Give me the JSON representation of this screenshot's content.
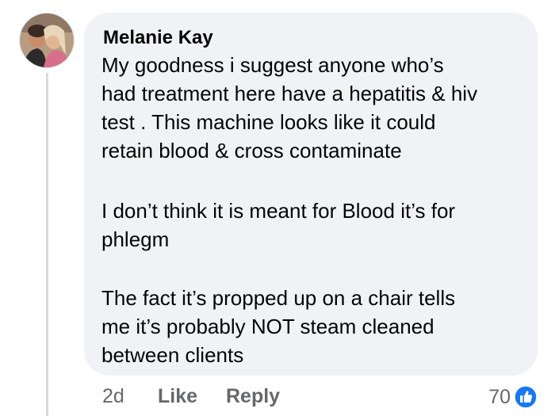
{
  "comment": {
    "author": "Melanie Kay",
    "paragraphs": [
      [
        "My goodness i suggest anyone who’s",
        "had treatment here have a hepatitis & hiv",
        "test . This machine looks like it could",
        "retain blood & cross contaminate"
      ],
      [
        "I don’t think it is meant for Blood it’s for",
        "phlegm"
      ],
      [
        "The fact it’s propped up on a chair tells",
        "me it’s probably NOT steam cleaned",
        "between clients"
      ]
    ],
    "timestamp": "2d",
    "like_label": "Like",
    "reply_label": "Reply",
    "reaction_count": "70",
    "reaction_icon": "thumbs-up-icon"
  },
  "colors": {
    "bubble_background": "#f0f2f5",
    "meta_text": "#65676b",
    "like_blue": "#1877f2",
    "thread_line": "#d7dadf"
  }
}
